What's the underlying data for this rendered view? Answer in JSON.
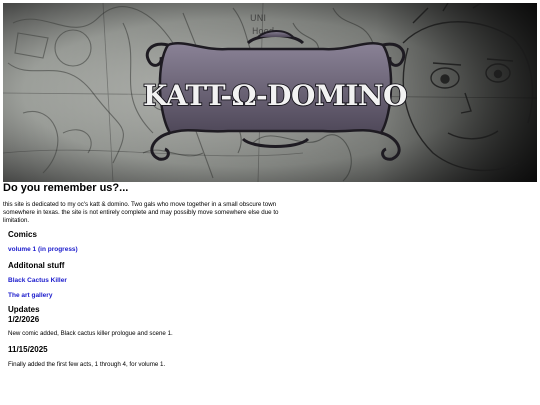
{
  "banner": {
    "logo_text": "KATT-Ω-DOMINO",
    "background_scribble_text": "Hood"
  },
  "main": {
    "heading": "Do you remember us?...",
    "intro": "this site is dedicated to my oc's katt & domino. Two gals who move together in a small obscure town somewhere in texas. the site is not entirely complete and may possibly move somewhere else due to limitation."
  },
  "comics": {
    "heading": "Comics",
    "links": [
      {
        "label": "volume 1 (in progress)"
      }
    ]
  },
  "additional": {
    "heading": "Additonal stuff",
    "links": [
      {
        "label": "Black Cactus Killer"
      },
      {
        "label": "The art gallery"
      }
    ]
  },
  "updates": {
    "heading": "Updates",
    "entries": [
      {
        "date": "1/2/2026",
        "text": "New comic added, Black cactus killer prologue and scene 1."
      },
      {
        "date": "11/15/2025",
        "text": "Finally added the first few acts, 1 through 4, for volume 1."
      }
    ]
  },
  "colors": {
    "link": "#1a1acc",
    "logo_fill": "#6a6276",
    "logo_text": "#f2f2f2"
  }
}
